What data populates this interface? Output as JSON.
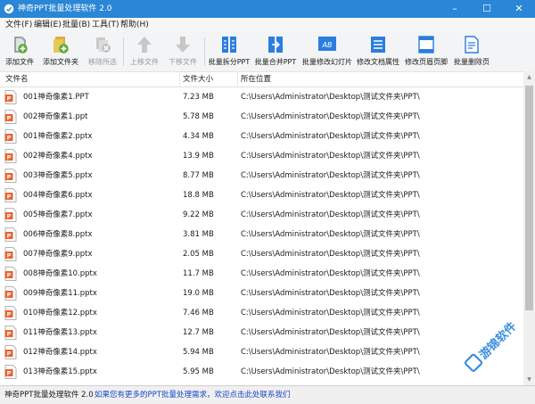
{
  "window": {
    "title": "神奇PPT批量处理软件 2.0",
    "controls": [
      "–",
      "☐",
      "✕"
    ]
  },
  "menu": [
    {
      "label": "文件(F)"
    },
    {
      "label": "编辑(E)"
    },
    {
      "label": "批量(B)"
    },
    {
      "label": "工具(T)"
    },
    {
      "label": "帮助(H)"
    }
  ],
  "toolbar": [
    {
      "label": "添加文件",
      "icon": "add-file-icon",
      "enabled": true
    },
    {
      "label": "添加文件夹",
      "icon": "add-folder-icon",
      "enabled": true
    },
    {
      "label": "移除所选",
      "icon": "remove-selected-icon",
      "enabled": false
    },
    {
      "label": "上移文件",
      "icon": "arrow-up-icon",
      "enabled": false
    },
    {
      "label": "下移文件",
      "icon": "arrow-down-icon",
      "enabled": false
    },
    {
      "label": "批量拆分PPT",
      "icon": "split-icon",
      "enabled": true
    },
    {
      "label": "批量合并PPT",
      "icon": "merge-icon",
      "enabled": true
    },
    {
      "label": "批量修改幻灯片",
      "icon": "ab-slide-icon",
      "enabled": true
    },
    {
      "label": "修改文档属性",
      "icon": "properties-icon",
      "enabled": true
    },
    {
      "label": "修改页眉页脚",
      "icon": "header-footer-icon",
      "enabled": true
    },
    {
      "label": "批量删除页",
      "icon": "delete-page-icon",
      "enabled": true
    }
  ],
  "table": {
    "columns": [
      "文件名",
      "文件大小",
      "所在位置"
    ],
    "rows": [
      {
        "name": "001神奇像素1.PPT",
        "size": "7.23 MB",
        "path": "C:\\Users\\Administrator\\Desktop\\测试文件夹\\PPT\\"
      },
      {
        "name": "002神奇像素1.ppt",
        "size": "5.78 MB",
        "path": "C:\\Users\\Administrator\\Desktop\\测试文件夹\\PPT\\"
      },
      {
        "name": "001神奇像素2.pptx",
        "size": "4.34 MB",
        "path": "C:\\Users\\Administrator\\Desktop\\测试文件夹\\PPT\\"
      },
      {
        "name": "002神奇像素4.pptx",
        "size": "13.9 MB",
        "path": "C:\\Users\\Administrator\\Desktop\\测试文件夹\\PPT\\"
      },
      {
        "name": "003神奇像素5.pptx",
        "size": "8.77 MB",
        "path": "C:\\Users\\Administrator\\Desktop\\测试文件夹\\PPT\\"
      },
      {
        "name": "004神奇像素6.pptx",
        "size": "18.8 MB",
        "path": "C:\\Users\\Administrator\\Desktop\\测试文件夹\\PPT\\"
      },
      {
        "name": "005神奇像素7.pptx",
        "size": "9.22 MB",
        "path": "C:\\Users\\Administrator\\Desktop\\测试文件夹\\PPT\\"
      },
      {
        "name": "006神奇像素8.pptx",
        "size": "3.81 MB",
        "path": "C:\\Users\\Administrator\\Desktop\\测试文件夹\\PPT\\"
      },
      {
        "name": "007神奇像素9.pptx",
        "size": "2.05 MB",
        "path": "C:\\Users\\Administrator\\Desktop\\测试文件夹\\PPT\\"
      },
      {
        "name": "008神奇像素10.pptx",
        "size": "11.7 MB",
        "path": "C:\\Users\\Administrator\\Desktop\\测试文件夹\\PPT\\"
      },
      {
        "name": "009神奇像素11.pptx",
        "size": "19.0 MB",
        "path": "C:\\Users\\Administrator\\Desktop\\测试文件夹\\PPT\\"
      },
      {
        "name": "010神奇像素12.pptx",
        "size": "7.46 MB",
        "path": "C:\\Users\\Administrator\\Desktop\\测试文件夹\\PPT\\"
      },
      {
        "name": "011神奇像素13.pptx",
        "size": "12.7 MB",
        "path": "C:\\Users\\Administrator\\Desktop\\测试文件夹\\PPT\\"
      },
      {
        "name": "012神奇像素14.pptx",
        "size": "5.94 MB",
        "path": "C:\\Users\\Administrator\\Desktop\\测试文件夹\\PPT\\"
      },
      {
        "name": "013神奇像素15.pptx",
        "size": "5.95 MB",
        "path": "C:\\Users\\Administrator\\Desktop\\测试文件夹\\PPT\\"
      }
    ]
  },
  "status": {
    "app": "神奇PPT批量处理软件 2.0",
    "link": "如果您有更多的PPT批量处理需求，欢迎点击此处联系我们"
  },
  "watermark": {
    "text": "游锦软件"
  },
  "colors": {
    "titlebar": "#2a86d6",
    "accent": "#2b7de0",
    "ppt_orange": "#e8632e",
    "link": "#1a47c8",
    "watermark": "#3a8fdf"
  }
}
